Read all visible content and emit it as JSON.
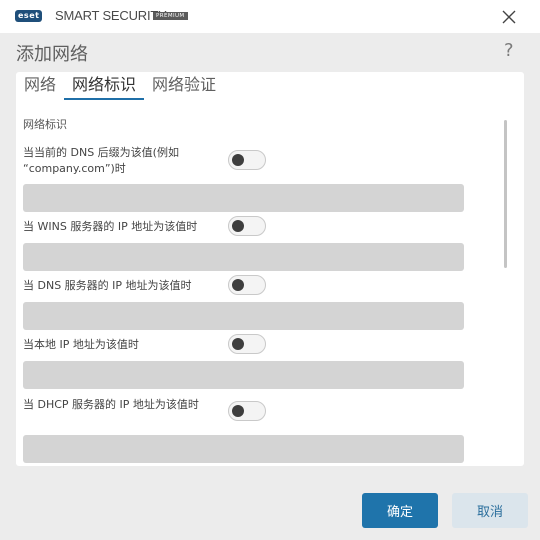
{
  "window": {
    "brand_logo": "eset",
    "product": "SMART SECURITY",
    "edition": "PREMIUM",
    "close_icon": "close-icon"
  },
  "page": {
    "title": "添加网络",
    "help_symbol": "?"
  },
  "tabs": [
    {
      "label": "网络",
      "active": false
    },
    {
      "label": "网络标识",
      "active": true
    },
    {
      "label": "网络验证",
      "active": false
    }
  ],
  "section": {
    "label": "网络标识"
  },
  "conditions": [
    {
      "label": "当当前的 DNS 后缀为该值(例如 “company.com”)时",
      "enabled": false,
      "value": ""
    },
    {
      "label": "当 WINS 服务器的 IP 地址为该值时",
      "enabled": false,
      "value": ""
    },
    {
      "label": "当 DNS 服务器的 IP 地址为该值时",
      "enabled": false,
      "value": ""
    },
    {
      "label": "当本地 IP 地址为该值时",
      "enabled": false,
      "value": ""
    },
    {
      "label": "当 DHCP 服务器的 IP 地址为该值时",
      "enabled": false,
      "value": ""
    }
  ],
  "buttons": {
    "ok": "确定",
    "cancel": "取消"
  },
  "colors": {
    "accent": "#1f74ab",
    "logo": "#1f4f7a",
    "field_bg": "#d4d4d4"
  }
}
